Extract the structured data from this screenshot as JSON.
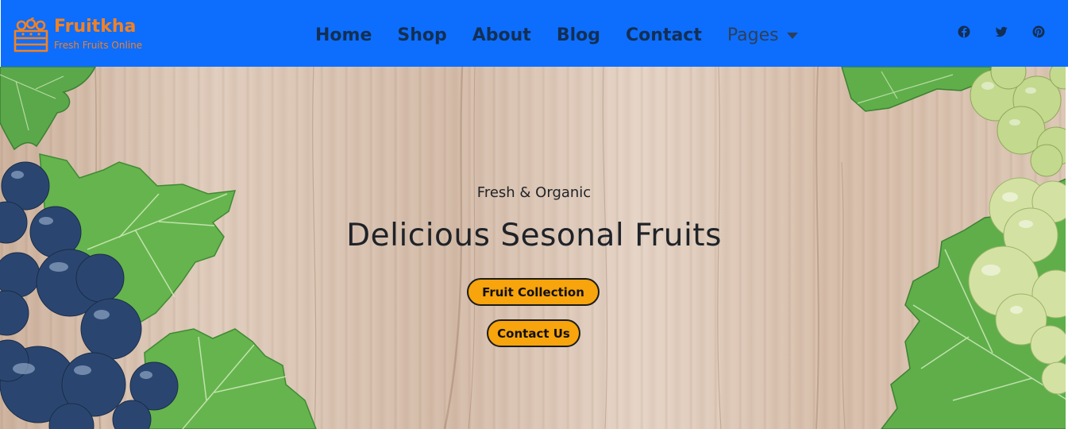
{
  "brand": {
    "name": "Fruitkha",
    "tagline": "Fresh Fruits Online"
  },
  "nav": {
    "items": [
      {
        "label": "Home"
      },
      {
        "label": "Shop"
      },
      {
        "label": "About"
      },
      {
        "label": "Blog"
      },
      {
        "label": "Contact"
      },
      {
        "label": "Pages"
      }
    ]
  },
  "socials": [
    {
      "icon": "facebook-icon"
    },
    {
      "icon": "twitter-icon"
    },
    {
      "icon": "pinterest-icon"
    }
  ],
  "hero": {
    "subtitle": "Fresh & Organic",
    "title": "Delicious Sesonal Fruits",
    "primary_button": "Fruit Collection",
    "secondary_button": "Contact Us"
  },
  "colors": {
    "navbar_bg": "#0d6efd",
    "brand": "#f28123",
    "nav_text": "#132f55",
    "button_bg": "#f8a40c",
    "text_dark": "#1f2328"
  }
}
